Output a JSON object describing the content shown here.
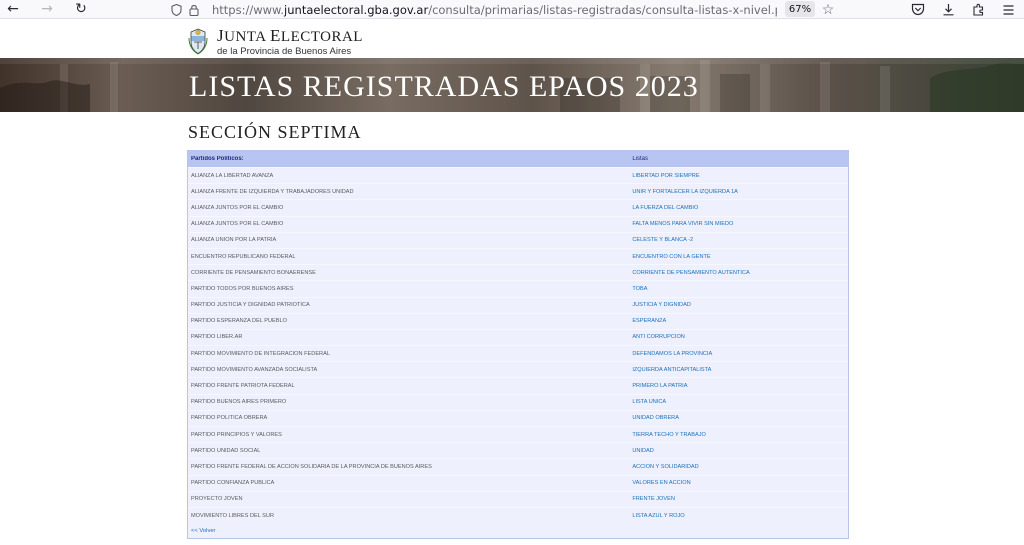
{
  "browser": {
    "url_prefix": "https://www.",
    "url_host": "juntaelectoral.gba.gov.ar",
    "url_path": "/consulta/primarias/listas-registradas/consulta-listas-x-nivel.php?accion=requerir&",
    "zoom": "67%"
  },
  "header": {
    "title_first": "J",
    "title_rest1": "UNTA ",
    "title_second": "E",
    "title_rest2": "LECTORAL",
    "subtitle": "de la Provincia de Buenos Aires"
  },
  "banner": {
    "title": "LISTAS REGISTRADAS EPAOS 2023"
  },
  "section": {
    "title": "SECCIÓN SEPTIMA"
  },
  "table": {
    "headers": {
      "party": "Partidos Politicos:",
      "list": "Listas"
    },
    "rows": [
      {
        "party": "ALIANZA LA LIBERTAD AVANZA",
        "list": "LIBERTAD POR SIEMPRE"
      },
      {
        "party": "ALIANZA FRENTE DE IZQUIERDA Y TRABAJADORES UNIDAD",
        "list": "UNIR Y FORTALECER LA IZQUIERDA 1A"
      },
      {
        "party": "ALIANZA JUNTOS POR EL CAMBIO",
        "list": "LA FUERZA DEL CAMBIO"
      },
      {
        "party": "ALIANZA JUNTOS POR EL CAMBIO",
        "list": "FALTA MENOS PARA VIVIR SIN MIEDO"
      },
      {
        "party": "ALIANZA UNION POR LA PATRIA",
        "list": "CELESTE Y BLANCA -2"
      },
      {
        "party": "ENCUENTRO REPUBLICANO FEDERAL",
        "list": "ENCUENTRO CON LA GENTE"
      },
      {
        "party": "CORRIENTE DE PENSAMIENTO BONAERENSE",
        "list": "CORRIENTE DE PENSAMIENTO AUTENTICA"
      },
      {
        "party": "PARTIDO TODOS POR BUENOS AIRES",
        "list": "TOBA"
      },
      {
        "party": "PARTIDO JUSTICIA Y DIGNIDAD PATRIOTICA",
        "list": "JUSTICIA Y DIGNIDAD"
      },
      {
        "party": "PARTIDO ESPERANZA DEL PUEBLO",
        "list": "ESPERANZA"
      },
      {
        "party": "PARTIDO LIBER.AR",
        "list": "ANTI CORRUPCION"
      },
      {
        "party": "PARTIDO MOVIMIENTO DE INTEGRACION FEDERAL",
        "list": "DEFENDAMOS LA PROVINCIA"
      },
      {
        "party": "PARTIDO MOVIMIENTO AVANZADA SOCIALISTA",
        "list": "IZQUIERDA ANTICAPITALISTA"
      },
      {
        "party": "PARTIDO FRENTE PATRIOTA FEDERAL",
        "list": "PRIMERO LA PATRIA"
      },
      {
        "party": "PARTIDO BUENOS AIRES PRIMERO",
        "list": "LISTA UNICA"
      },
      {
        "party": "PARTIDO POLITICA OBRERA",
        "list": "UNIDAD OBRERA"
      },
      {
        "party": "PARTIDO PRINCIPIOS Y VALORES",
        "list": "TIERRA TECHO Y TRABAJO"
      },
      {
        "party": "PARTIDO UNIDAD SOCIAL",
        "list": "UNIDAD"
      },
      {
        "party": "PARTIDO FRENTE FEDERAL DE ACCION SOLIDARIA DE LA PROVINCIA DE BUENOS AIRES",
        "list": "ACCION Y SOLIDARIDAD"
      },
      {
        "party": "PARTIDO CONFIANZA PUBLICA",
        "list": "VALORES EN ACCION"
      },
      {
        "party": "PROYECTO JOVEN",
        "list": "FRENTE JOVEN"
      },
      {
        "party": "MOVIMIENTO LIBRES DEL SUR",
        "list": "LISTA AZUL Y ROJO"
      }
    ],
    "back_link": "<< Volver"
  }
}
